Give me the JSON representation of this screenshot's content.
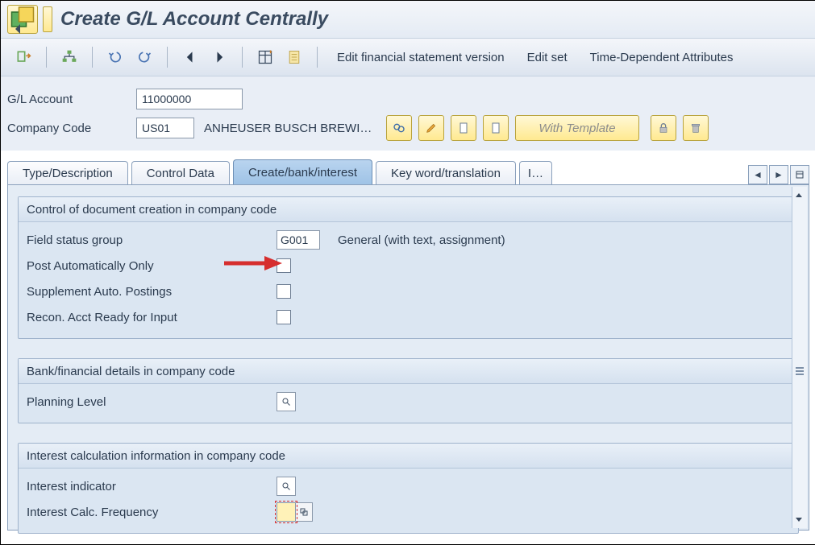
{
  "title": "Create G/L Account Centrally",
  "toolbar": {
    "links": {
      "edit_fsv": "Edit financial statement version",
      "edit_set": "Edit set",
      "time_dep": "Time-Dependent Attributes"
    }
  },
  "header": {
    "gl_account_label": "G/L Account",
    "gl_account_value": "11000000",
    "company_code_label": "Company Code",
    "company_code_value": "US01",
    "company_code_desc": "ANHEUSER BUSCH BREWI…",
    "with_template": "With Template"
  },
  "tabs": {
    "t1": "Type/Description",
    "t2": "Control Data",
    "t3": "Create/bank/interest",
    "t4": "Key word/translation",
    "t5": "I…"
  },
  "groups": {
    "g1_title": "Control of document creation in company code",
    "field_status_group_label": "Field status group",
    "field_status_group_value": "G001",
    "field_status_group_desc": "General (with text, assignment)",
    "post_auto_label": "Post Automatically Only",
    "supplement_label": "Supplement Auto. Postings",
    "recon_label": "Recon. Acct Ready for Input",
    "g2_title": "Bank/financial details in company code",
    "planning_level_label": "Planning Level",
    "g3_title": "Interest calculation information in company code",
    "interest_indicator_label": "Interest indicator",
    "interest_calc_freq_label": "Interest Calc. Frequency"
  }
}
